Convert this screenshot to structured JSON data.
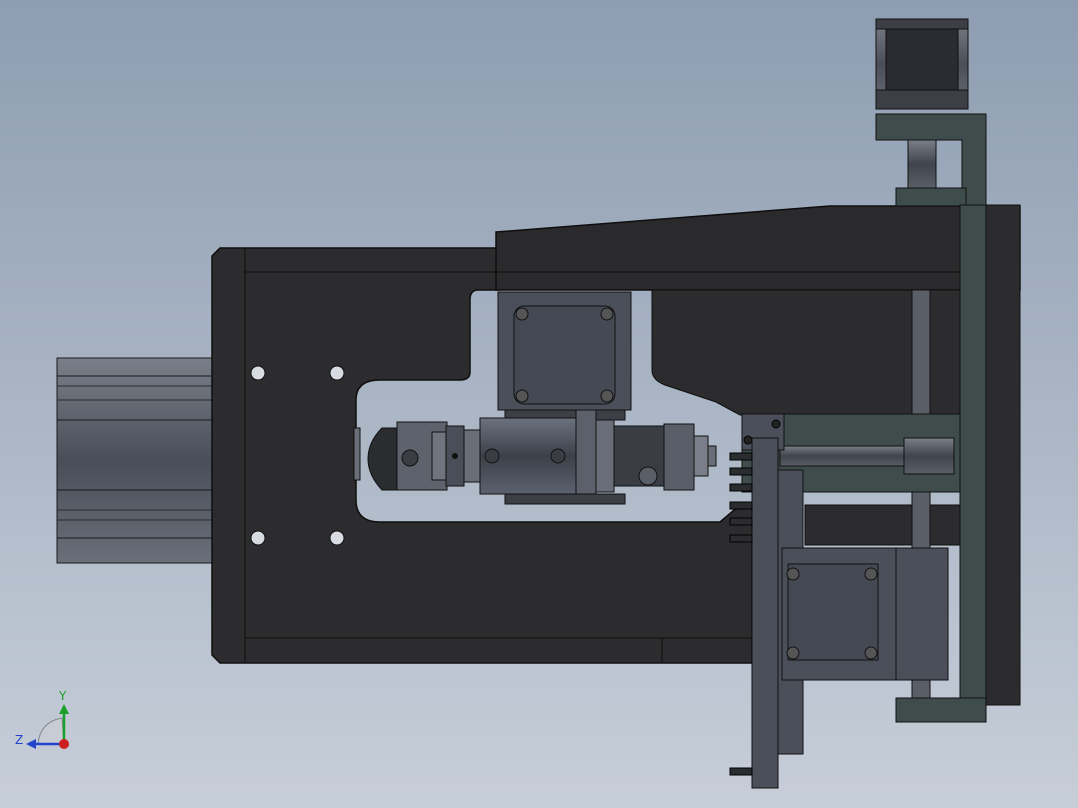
{
  "viewport": {
    "background_top": "#8e9db2",
    "background_bottom": "#c7ced9",
    "body_color": "#2b2b2d",
    "panel_color": "#4a4f5a",
    "frame_color": "#3a4b4a"
  },
  "triad": {
    "y_label": "Y",
    "z_label": "Z",
    "y_color": "#1aa02a",
    "z_color": "#2244cc",
    "origin_color": "#cc2020"
  }
}
